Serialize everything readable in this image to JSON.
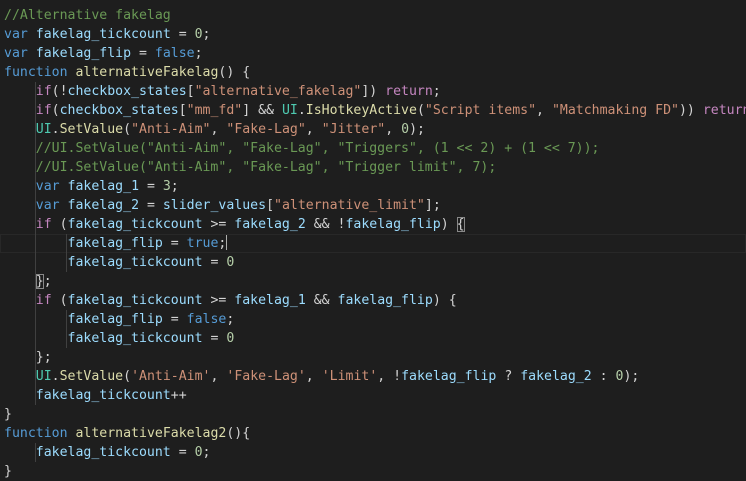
{
  "editor": {
    "lines": [
      {
        "indent": 0,
        "tokens": [
          [
            "comment",
            "//Alternative fakelag"
          ]
        ]
      },
      {
        "indent": 0,
        "tokens": [
          [
            "kw",
            "var"
          ],
          [
            "punc",
            " "
          ],
          [
            "var",
            "fakelag_tickcount"
          ],
          [
            "punc",
            " = "
          ],
          [
            "num",
            "0"
          ],
          [
            "punc",
            ";"
          ]
        ]
      },
      {
        "indent": 0,
        "tokens": [
          [
            "kw",
            "var"
          ],
          [
            "punc",
            " "
          ],
          [
            "var",
            "fakelag_flip"
          ],
          [
            "punc",
            " = "
          ],
          [
            "kw",
            "false"
          ],
          [
            "punc",
            ";"
          ]
        ]
      },
      {
        "indent": 0,
        "tokens": [
          [
            "kw",
            "function"
          ],
          [
            "punc",
            " "
          ],
          [
            "fn",
            "alternativeFakelag"
          ],
          [
            "punc",
            "() {"
          ]
        ]
      },
      {
        "indent": 1,
        "tokens": [
          [
            "ctrl",
            "if"
          ],
          [
            "punc",
            "(!"
          ],
          [
            "var",
            "checkbox_states"
          ],
          [
            "punc",
            "["
          ],
          [
            "str",
            "\"alternative_fakelag\""
          ],
          [
            "punc",
            "]) "
          ],
          [
            "ctrl",
            "return"
          ],
          [
            "punc",
            ";"
          ]
        ]
      },
      {
        "indent": 1,
        "tokens": [
          [
            "ctrl",
            "if"
          ],
          [
            "punc",
            "("
          ],
          [
            "var",
            "checkbox_states"
          ],
          [
            "punc",
            "["
          ],
          [
            "str",
            "\"mm_fd\""
          ],
          [
            "punc",
            "] && "
          ],
          [
            "cls",
            "UI"
          ],
          [
            "punc",
            "."
          ],
          [
            "fn",
            "IsHotkeyActive"
          ],
          [
            "punc",
            "("
          ],
          [
            "str",
            "\"Script items\""
          ],
          [
            "punc",
            ", "
          ],
          [
            "str",
            "\"Matchmaking FD\""
          ],
          [
            "punc",
            ")) "
          ],
          [
            "ctrl",
            "return"
          ],
          [
            "punc",
            ";"
          ]
        ]
      },
      {
        "indent": 1,
        "tokens": [
          [
            "cls",
            "UI"
          ],
          [
            "punc",
            "."
          ],
          [
            "fn",
            "SetValue"
          ],
          [
            "punc",
            "("
          ],
          [
            "str",
            "\"Anti-Aim\""
          ],
          [
            "punc",
            ", "
          ],
          [
            "str",
            "\"Fake-Lag\""
          ],
          [
            "punc",
            ", "
          ],
          [
            "str",
            "\"Jitter\""
          ],
          [
            "punc",
            ", "
          ],
          [
            "num",
            "0"
          ],
          [
            "punc",
            ");"
          ]
        ]
      },
      {
        "indent": 1,
        "tokens": [
          [
            "comment",
            "//UI.SetValue(\"Anti-Aim\", \"Fake-Lag\", \"Triggers\", (1 << 2) + (1 << 7));"
          ]
        ]
      },
      {
        "indent": 1,
        "tokens": [
          [
            "comment",
            "//UI.SetValue(\"Anti-Aim\", \"Fake-Lag\", \"Trigger limit\", 7);"
          ]
        ]
      },
      {
        "indent": 1,
        "tokens": [
          [
            "kw",
            "var"
          ],
          [
            "punc",
            " "
          ],
          [
            "var",
            "fakelag_1"
          ],
          [
            "punc",
            " = "
          ],
          [
            "num",
            "3"
          ],
          [
            "punc",
            ";"
          ]
        ]
      },
      {
        "indent": 1,
        "tokens": [
          [
            "kw",
            "var"
          ],
          [
            "punc",
            " "
          ],
          [
            "var",
            "fakelag_2"
          ],
          [
            "punc",
            " = "
          ],
          [
            "var",
            "slider_values"
          ],
          [
            "punc",
            "["
          ],
          [
            "str",
            "\"alternative_limit\""
          ],
          [
            "punc",
            "];"
          ]
        ]
      },
      {
        "indent": 1,
        "tokens": [
          [
            "ctrl",
            "if"
          ],
          [
            "punc",
            " ("
          ],
          [
            "var",
            "fakelag_tickcount"
          ],
          [
            "punc",
            " >= "
          ],
          [
            "var",
            "fakelag_2"
          ],
          [
            "punc",
            " && !"
          ],
          [
            "var",
            "fakelag_flip"
          ],
          [
            "punc",
            ") "
          ],
          [
            "bracket",
            "{"
          ]
        ]
      },
      {
        "indent": 2,
        "current": true,
        "tokens": [
          [
            "var",
            "fakelag_flip"
          ],
          [
            "punc",
            " = "
          ],
          [
            "kw",
            "true"
          ],
          [
            "punc",
            ";"
          ],
          [
            "cursor",
            ""
          ]
        ]
      },
      {
        "indent": 2,
        "tokens": [
          [
            "var",
            "fakelag_tickcount"
          ],
          [
            "punc",
            " = "
          ],
          [
            "num",
            "0"
          ]
        ]
      },
      {
        "indent": 1,
        "tokens": [
          [
            "bracket",
            "}"
          ],
          [
            "punc",
            ";"
          ]
        ]
      },
      {
        "indent": 1,
        "tokens": [
          [
            "ctrl",
            "if"
          ],
          [
            "punc",
            " ("
          ],
          [
            "var",
            "fakelag_tickcount"
          ],
          [
            "punc",
            " >= "
          ],
          [
            "var",
            "fakelag_1"
          ],
          [
            "punc",
            " && "
          ],
          [
            "var",
            "fakelag_flip"
          ],
          [
            "punc",
            ") {"
          ]
        ]
      },
      {
        "indent": 2,
        "tokens": [
          [
            "var",
            "fakelag_flip"
          ],
          [
            "punc",
            " = "
          ],
          [
            "kw",
            "false"
          ],
          [
            "punc",
            ";"
          ]
        ]
      },
      {
        "indent": 2,
        "tokens": [
          [
            "var",
            "fakelag_tickcount"
          ],
          [
            "punc",
            " = "
          ],
          [
            "num",
            "0"
          ]
        ]
      },
      {
        "indent": 1,
        "tokens": [
          [
            "punc",
            "};"
          ]
        ]
      },
      {
        "indent": 1,
        "tokens": [
          [
            "cls",
            "UI"
          ],
          [
            "punc",
            "."
          ],
          [
            "fn",
            "SetValue"
          ],
          [
            "punc",
            "("
          ],
          [
            "str",
            "'Anti-Aim'"
          ],
          [
            "punc",
            ", "
          ],
          [
            "str",
            "'Fake-Lag'"
          ],
          [
            "punc",
            ", "
          ],
          [
            "str",
            "'Limit'"
          ],
          [
            "punc",
            ", !"
          ],
          [
            "var",
            "fakelag_flip"
          ],
          [
            "punc",
            " ? "
          ],
          [
            "var",
            "fakelag_2"
          ],
          [
            "punc",
            " : "
          ],
          [
            "num",
            "0"
          ],
          [
            "punc",
            ");"
          ]
        ]
      },
      {
        "indent": 1,
        "tokens": [
          [
            "var",
            "fakelag_tickcount"
          ],
          [
            "punc",
            "++"
          ]
        ]
      },
      {
        "indent": 0,
        "tokens": [
          [
            "punc",
            "}"
          ]
        ]
      },
      {
        "indent": 0,
        "tokens": [
          [
            "kw",
            "function"
          ],
          [
            "punc",
            " "
          ],
          [
            "fn",
            "alternativeFakelag2"
          ],
          [
            "punc",
            "(){"
          ]
        ]
      },
      {
        "indent": 1,
        "tokens": [
          [
            "var",
            "fakelag_tickcount"
          ],
          [
            "punc",
            " = "
          ],
          [
            "num",
            "0"
          ],
          [
            "punc",
            ";"
          ]
        ]
      },
      {
        "indent": 0,
        "tokens": [
          [
            "punc",
            "}"
          ]
        ]
      }
    ]
  },
  "colors": {
    "background": "#1e1e1e",
    "comment": "#6a9955",
    "keyword": "#569cd6",
    "control": "#c586c0",
    "variable": "#9cdcfe",
    "function": "#dcdcaa",
    "string": "#ce9178",
    "number": "#b5cea8",
    "class": "#4ec9b0"
  }
}
